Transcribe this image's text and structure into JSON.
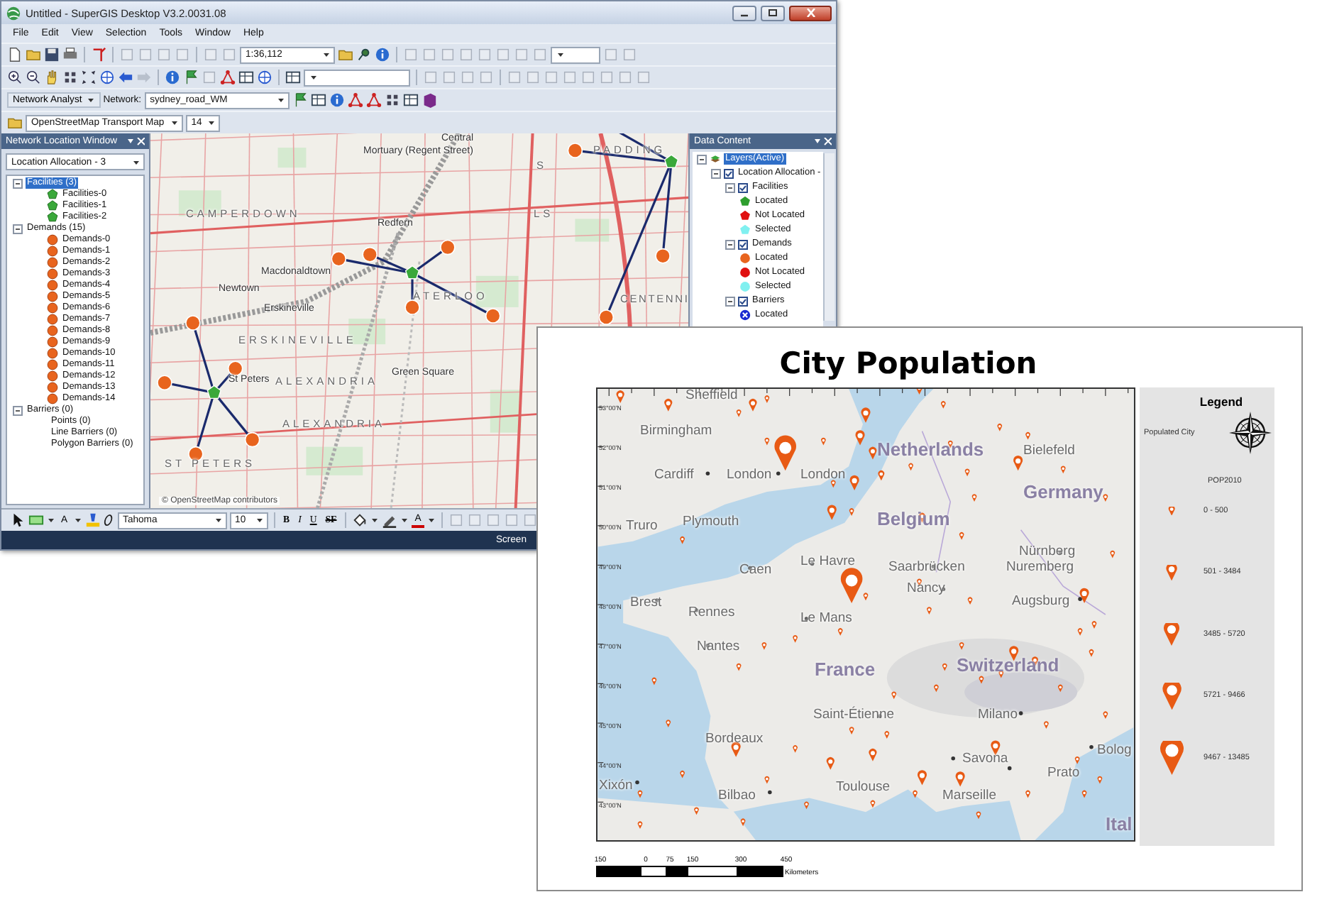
{
  "app_window": {
    "title": "Untitled - SuperGIS Desktop V3.2.0031.08",
    "menu": [
      "File",
      "Edit",
      "View",
      "Selection",
      "Tools",
      "Window",
      "Help"
    ],
    "standard_toolbar": {
      "scale": "1:36,112"
    },
    "network_toolbar": {
      "analyst_menu": "Network Analyst",
      "network_label": "Network:",
      "network": "sydney_road_WM"
    },
    "basemap_toolbar": {
      "basemap": "OpenStreetMap Transport Map",
      "zoom_level": "14"
    },
    "network_location_window": {
      "title": "Network Location Window",
      "analysis": "Location Allocation - 3",
      "tree": [
        {
          "label": "Facilities (3)",
          "selected": true,
          "expanded": true,
          "children": [
            {
              "label": "Facilities-0",
              "kind": "facility",
              "selected": false
            },
            {
              "label": "Facilities-1",
              "kind": "facility",
              "selected": false
            },
            {
              "label": "Facilities-2",
              "kind": "facility",
              "selected": false
            }
          ]
        },
        {
          "label": "Demands (15)",
          "selected": false,
          "expanded": true,
          "children": [
            {
              "label": "Demands-0",
              "kind": "demand",
              "selected": false
            },
            {
              "label": "Demands-1",
              "kind": "demand",
              "selected": false
            },
            {
              "label": "Demands-2",
              "kind": "demand",
              "selected": false
            },
            {
              "label": "Demands-3",
              "kind": "demand",
              "selected": false
            },
            {
              "label": "Demands-4",
              "kind": "demand",
              "selected": false
            },
            {
              "label": "Demands-5",
              "kind": "demand",
              "selected": false
            },
            {
              "label": "Demands-6",
              "kind": "demand",
              "selected": false
            },
            {
              "label": "Demands-7",
              "kind": "demand",
              "selected": false
            },
            {
              "label": "Demands-8",
              "kind": "demand",
              "selected": false
            },
            {
              "label": "Demands-9",
              "kind": "demand",
              "selected": false
            },
            {
              "label": "Demands-10",
              "kind": "demand",
              "selected": false
            },
            {
              "label": "Demands-11",
              "kind": "demand",
              "selected": false
            },
            {
              "label": "Demands-12",
              "kind": "demand",
              "selected": false
            },
            {
              "label": "Demands-13",
              "kind": "demand",
              "selected": false
            },
            {
              "label": "Demands-14",
              "kind": "demand",
              "selected": false
            }
          ]
        },
        {
          "label": "Barriers (0)",
          "selected": false,
          "expanded": true,
          "children": [
            {
              "label": "Points (0)",
              "kind": "plain",
              "selected": false
            },
            {
              "label": "Line Barriers (0)",
              "kind": "plain",
              "selected": false
            },
            {
              "label": "Polygon Barriers (0)",
              "kind": "plain",
              "selected": false
            }
          ]
        }
      ]
    },
    "map": {
      "labels": [
        {
          "text": "Central",
          "kind": "place"
        },
        {
          "text": "Mortuary (Regent Street)",
          "kind": "place"
        },
        {
          "text": "S",
          "kind": "district"
        },
        {
          "text": "PADDING",
          "kind": "district"
        },
        {
          "text": "CAMPERDOWN",
          "kind": "district"
        },
        {
          "text": "LS",
          "kind": "district"
        },
        {
          "text": "Redfern",
          "kind": "place"
        },
        {
          "text": "Macdonaldtown",
          "kind": "place"
        },
        {
          "text": "Newtown",
          "kind": "place"
        },
        {
          "text": "ATERLOO",
          "kind": "district"
        },
        {
          "text": "CENTENNI",
          "kind": "district"
        },
        {
          "text": "Erskineville",
          "kind": "place"
        },
        {
          "text": "ERSKINEVILLE",
          "kind": "district"
        },
        {
          "text": "Green Square",
          "kind": "place"
        },
        {
          "text": "St Peters",
          "kind": "place"
        },
        {
          "text": "ALEXANDRIA",
          "kind": "district"
        },
        {
          "text": "ALEXANDRIA",
          "kind": "district"
        },
        {
          "text": "ST PETERS",
          "kind": "district"
        }
      ],
      "attribution": "© OpenStreetMap contributors"
    },
    "data_content": {
      "title": "Data Content",
      "tree": [
        {
          "label": "Layers(Active)",
          "kind": "layers",
          "selected": true,
          "expanded": true,
          "children": [
            {
              "label": "Location Allocation -",
              "checked": true,
              "selected": false,
              "expanded": true,
              "children": [
                {
                  "label": "Facilities",
                  "checked": true,
                  "selected": false,
                  "expanded": true,
                  "children": [
                    {
                      "label": "Located",
                      "kind": "pentagon",
                      "color": "#2e9e2e",
                      "selected": false
                    },
                    {
                      "label": "Not Located",
                      "kind": "pentagon",
                      "color": "#e01010",
                      "selected": false
                    },
                    {
                      "label": "Selected",
                      "kind": "pentagon",
                      "color": "#80f0f0",
                      "selected": false
                    }
                  ]
                },
                {
                  "label": "Demands",
                  "checked": true,
                  "selected": false,
                  "expanded": true,
                  "children": [
                    {
                      "label": "Located",
                      "kind": "circle",
                      "color": "#e8641e",
                      "selected": false
                    },
                    {
                      "label": "Not Located",
                      "kind": "circle",
                      "color": "#e01010",
                      "selected": false
                    },
                    {
                      "label": "Selected",
                      "kind": "circle",
                      "color": "#80f0f0",
                      "selected": false
                    }
                  ]
                },
                {
                  "label": "Barriers",
                  "checked": true,
                  "selected": false,
                  "expanded": true,
                  "children": [
                    {
                      "label": "Located",
                      "kind": "cross-circle",
                      "color": "#1a2ad0",
                      "selected": false
                    }
                  ]
                }
              ]
            }
          ]
        }
      ]
    },
    "drawing_toolbar": {
      "text_tool": "A",
      "font": "Tahoma",
      "font_size": "10",
      "styles": [
        "B",
        "I",
        "U",
        "SF"
      ],
      "font_color_tool": "A"
    },
    "status_bar": {
      "text": "Screen"
    }
  },
  "layout_window": {
    "title": "City Population",
    "map": {
      "lat_labels": [
        "53°00'N",
        "52°00'N",
        "51°00'N",
        "50°00'N",
        "49°00'N",
        "48°00'N",
        "47°00'N",
        "46°00'N",
        "45°00'N",
        "44°00'N",
        "43°00'N"
      ],
      "labels": [
        {
          "text": "Sheffield",
          "kind": "city"
        },
        {
          "text": "Birmingham",
          "kind": "city"
        },
        {
          "text": "Netherlands",
          "kind": "country"
        },
        {
          "text": "Bielefeld",
          "kind": "city"
        },
        {
          "text": "Cardiff",
          "kind": "city"
        },
        {
          "text": "London",
          "kind": "city"
        },
        {
          "text": "London",
          "kind": "city"
        },
        {
          "text": "Germany",
          "kind": "country"
        },
        {
          "text": "Truro",
          "kind": "city"
        },
        {
          "text": "Plymouth",
          "kind": "city"
        },
        {
          "text": "Belgium",
          "kind": "country"
        },
        {
          "text": "Le Havre",
          "kind": "city"
        },
        {
          "text": "Caen",
          "kind": "city"
        },
        {
          "text": "Saarbrücken",
          "kind": "city"
        },
        {
          "text": "Nürnberg",
          "kind": "city"
        },
        {
          "text": "Nuremberg",
          "kind": "city"
        },
        {
          "text": "Brest",
          "kind": "city"
        },
        {
          "text": "Rennes",
          "kind": "city"
        },
        {
          "text": "Le Mans",
          "kind": "city"
        },
        {
          "text": "Nancy",
          "kind": "city"
        },
        {
          "text": "Augsburg",
          "kind": "city"
        },
        {
          "text": "Nantes",
          "kind": "city"
        },
        {
          "text": "France",
          "kind": "country"
        },
        {
          "text": "Switzerland",
          "kind": "country"
        },
        {
          "text": "Saint-Étienne",
          "kind": "city"
        },
        {
          "text": "Milano",
          "kind": "city"
        },
        {
          "text": "Bordeaux",
          "kind": "city"
        },
        {
          "text": "Savona",
          "kind": "city"
        },
        {
          "text": "Bolog",
          "kind": "city"
        },
        {
          "text": "Prato",
          "kind": "city"
        },
        {
          "text": "Xixón",
          "kind": "city"
        },
        {
          "text": "Toulouse",
          "kind": "city"
        },
        {
          "text": "Bilbao",
          "kind": "city"
        },
        {
          "text": "Marseille",
          "kind": "city"
        },
        {
          "text": "Ital",
          "kind": "country"
        }
      ]
    },
    "legend": {
      "title": "Legend",
      "layer": "Populated City",
      "field": "POP2010",
      "classes": [
        "0 - 500",
        "501 - 3484",
        "3485 - 5720",
        "5721 - 9466",
        "9467 - 13485"
      ]
    },
    "scale_bar": {
      "ticks": [
        "150",
        "0",
        "75",
        "150",
        "300",
        "450"
      ],
      "unit": "Kilometers"
    }
  }
}
